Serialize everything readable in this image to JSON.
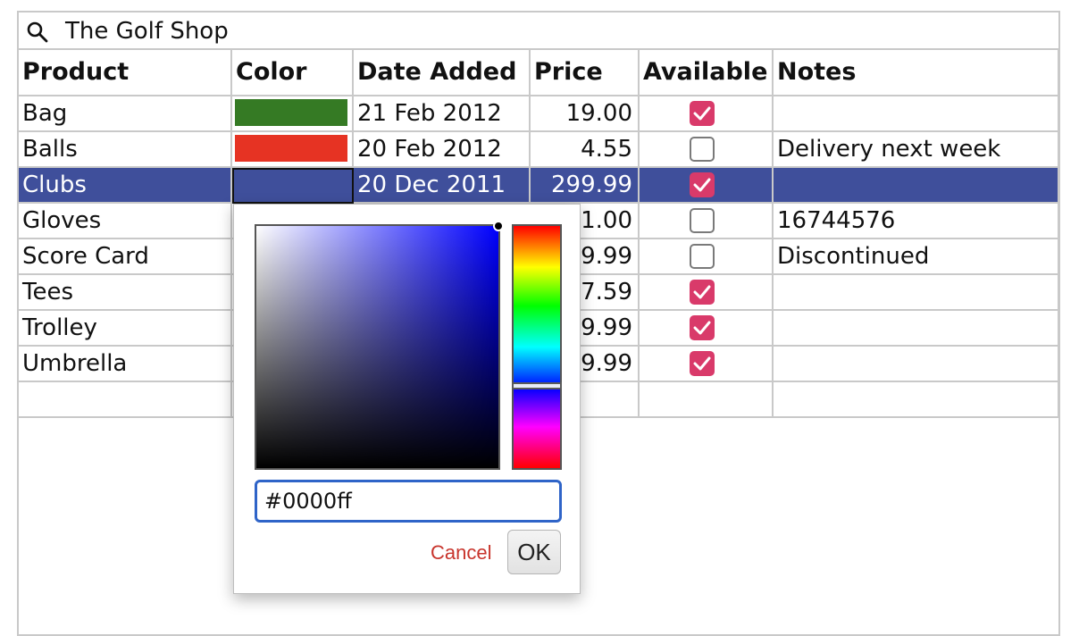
{
  "header": {
    "title": "The Golf Shop"
  },
  "columns": [
    "Product",
    "Color",
    "Date Added",
    "Price",
    "Available",
    "Notes"
  ],
  "rows": [
    {
      "product": "Bag",
      "color": "#357a24",
      "date": "21 Feb 2012",
      "price": "19.00",
      "available": true,
      "notes": ""
    },
    {
      "product": "Balls",
      "color": "#e63323",
      "date": "20 Feb 2012",
      "price": "4.55",
      "available": false,
      "notes": "Delivery next week"
    },
    {
      "product": "Clubs",
      "color": "#3f4f9b",
      "date": "20 Dec 2011",
      "price": "299.99",
      "available": true,
      "notes": ""
    },
    {
      "product": "Gloves",
      "color": "",
      "date": "",
      "price": "1.00",
      "available": false,
      "notes": "16744576"
    },
    {
      "product": "Score Card",
      "color": "",
      "date": "",
      "price": "9.99",
      "available": false,
      "notes": "Discontinued"
    },
    {
      "product": "Tees",
      "color": "",
      "date": "",
      "price": "7.59",
      "available": true,
      "notes": ""
    },
    {
      "product": "Trolley",
      "color": "",
      "date": "",
      "price": "9.99",
      "available": true,
      "notes": ""
    },
    {
      "product": "Umbrella",
      "color": "",
      "date": "",
      "price": "9.99",
      "available": true,
      "notes": ""
    }
  ],
  "selected_row": "Clubs",
  "color_picker": {
    "hex_value": "#0000ff",
    "cancel_label": "Cancel",
    "ok_label": "OK"
  },
  "colors": {
    "selection": "#3f4f9b",
    "checkbox_on": "#d93a6a",
    "input_focus": "#2f64c8",
    "cancel_text": "#c8342c"
  }
}
